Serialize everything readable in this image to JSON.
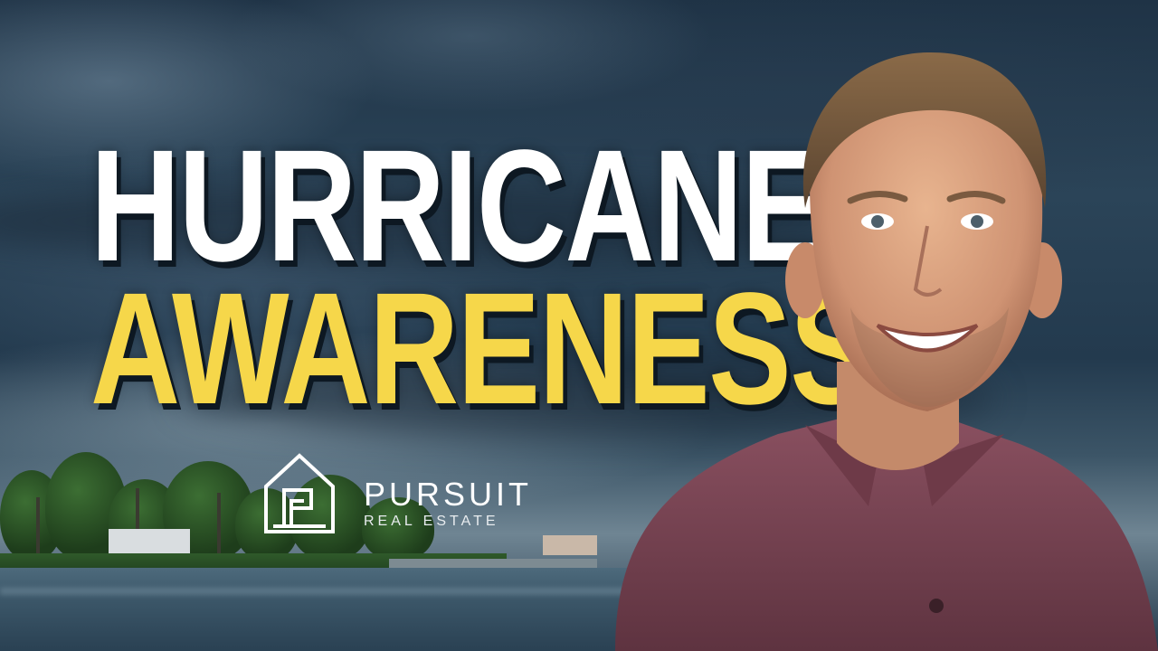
{
  "thumbnail": {
    "title_line1": "HURRICANE",
    "title_line2": "AWARENESS",
    "title_line1_color": "#ffffff",
    "title_line2_color": "#f6d74a"
  },
  "logo": {
    "name": "PURSUIT",
    "tagline": "REAL ESTATE",
    "color": "#ffffff"
  },
  "scene": {
    "sky_color": "#2b4458",
    "shirt_color": "#7a4450"
  }
}
